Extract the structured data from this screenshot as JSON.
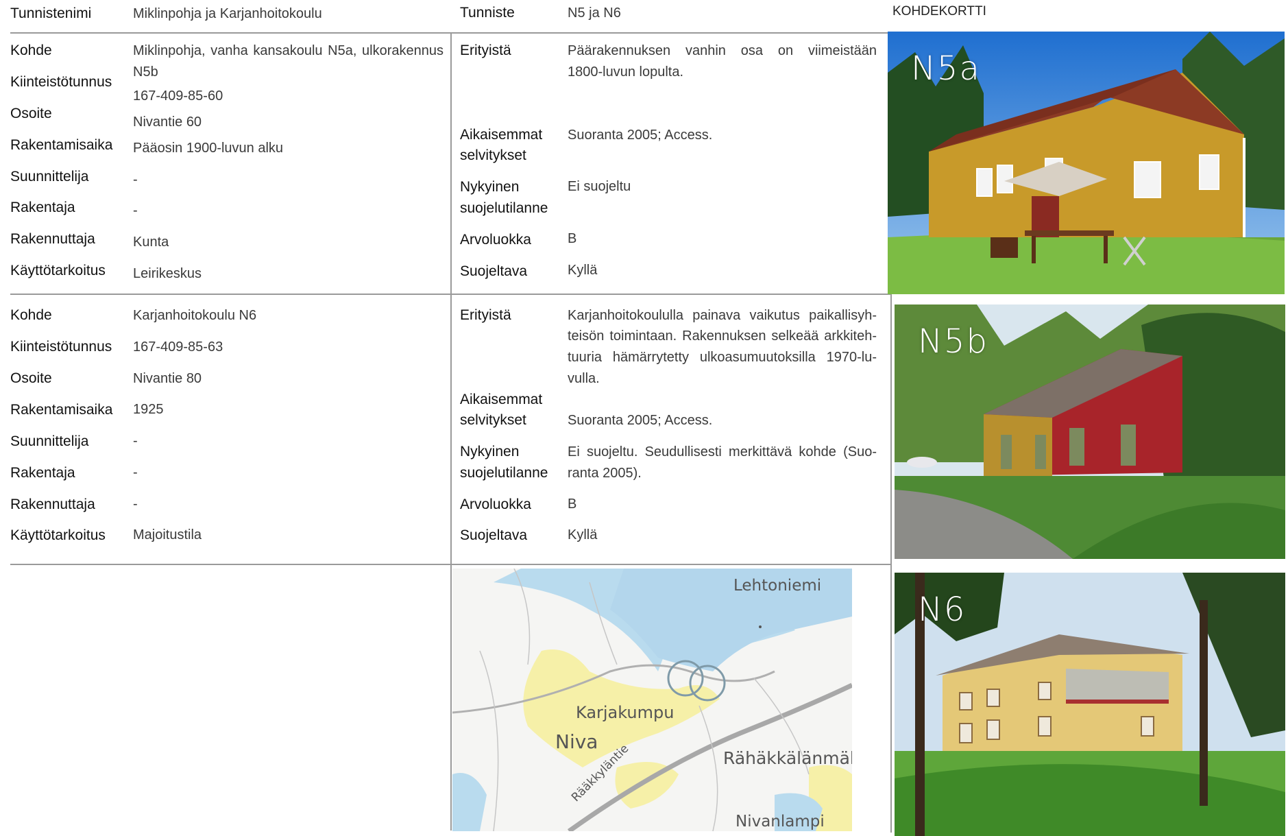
{
  "header": {
    "tunnistenimi_label": "Tunnistenimi",
    "tunnistenimi_value": "Miklinpohja ja Karjanhoitokoulu",
    "tunniste_label": "Tunniste",
    "tunniste_value": "N5 ja N6",
    "card_title": "KOHDEKORTTI"
  },
  "labels": {
    "kohde": "Kohde",
    "kiinteistotunnus": "Kiinteistötunnus",
    "osoite": "Osoite",
    "rakentamisaika": "Rakentamisaika",
    "suunnittelija": "Suunnittelija",
    "rakentaja": "Rakentaja",
    "rakennuttaja": "Rakennuttaja",
    "kayttotarkoitus": "Käyttötarkoitus",
    "erityista": "Erityistä",
    "aikaisemmat_1": "Aikaisemmat",
    "aikaisemmat_2": "selvitykset",
    "nykyinen_1": "Nykyinen",
    "nykyinen_2": "suojelutilanne",
    "arvoluokka": "Arvoluokka",
    "suojeltava": "Suojeltava"
  },
  "record1": {
    "kohde_line1": "Miklinpohja, vanha kansakoulu N5a, ulkorakennus",
    "kohde_line2": "N5b",
    "kiinteistotunnus": "167-409-85-60",
    "osoite": "Nivantie 60",
    "rakentamisaika": "Pääosin 1900-luvun alku",
    "suunnittelija": "-",
    "rakentaja": "-",
    "rakennuttaja": "Kunta",
    "kayttotarkoitus": "Leirikeskus",
    "erityista_line1": "Päärakennuksen vanhin osa on viimeistään",
    "erityista_line2": "1800-luvun lopulta.",
    "aikaisemmat": "Suoranta 2005; Access.",
    "nykyinen": "Ei suojeltu",
    "arvoluokka": "B",
    "suojeltava": "Kyllä"
  },
  "record2": {
    "kohde": "Karjanhoitokoulu N6",
    "kiinteistotunnus": "167-409-85-63",
    "osoite": "Nivantie 80",
    "rakentamisaika": "1925",
    "suunnittelija": "-",
    "rakentaja": "-",
    "rakennuttaja": "-",
    "kayttotarkoitus": "Majoitustila",
    "erityista_line1": "Karjanhoitokoululla painava vaikutus paikallisyh-",
    "erityista_line2": "teisön toimintaan. Rakennuksen selkeää arkkiteh-",
    "erityista_line3": "tuuria hämärrytetty ulkoasumuutoksilla 1970-lu-",
    "erityista_line4": "vulla.",
    "aikaisemmat": "Suoranta 2005; Access.",
    "nykyinen_line1": "Ei suojeltu. Seudullisesti merkittävä kohde (Suo-",
    "nykyinen_line2": "ranta 2005).",
    "arvoluokka": "B",
    "suojeltava": "Kyllä"
  },
  "photos": {
    "n5a": "N5a",
    "n5b": "N5b",
    "n6": "N6"
  },
  "map": {
    "lehtoniemi": "Lehtoniemi",
    "karjakumpu": "Karjakumpu",
    "niva": "Niva",
    "rahakkalanmaki": "Rähäkkälänmäk",
    "nivanlampi": "Nivanlampi",
    "road": "Rääkkyläntie"
  }
}
